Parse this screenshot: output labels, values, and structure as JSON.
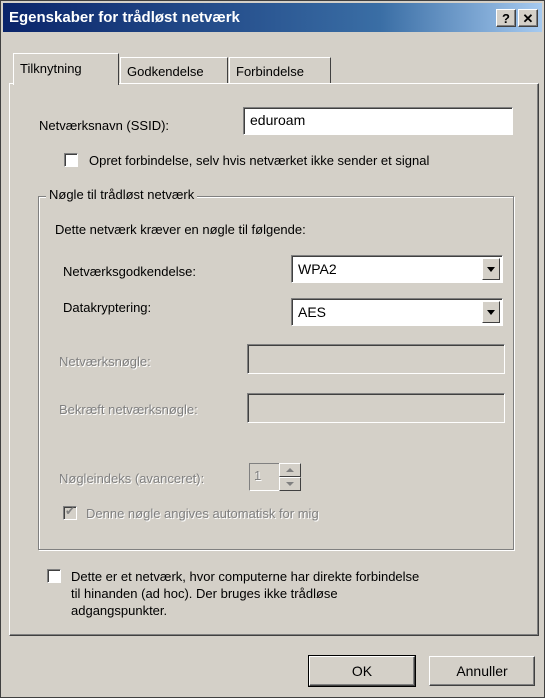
{
  "window": {
    "title": "Egenskaber for trådløst netværk",
    "help_label": "?",
    "close_label": "✕"
  },
  "tabs": [
    {
      "label": "Tilknytning",
      "active": true
    },
    {
      "label": "Godkendelse",
      "active": false
    },
    {
      "label": "Forbindelse",
      "active": false
    }
  ],
  "ssid": {
    "label": "Netværksnavn (SSID):",
    "value": "eduroam"
  },
  "connect_nonbroadcast": {
    "label": "Opret forbindelse, selv hvis netværket ikke sender et signal",
    "checked": false
  },
  "key_group": {
    "legend": "Nøgle til trådløst netværk",
    "intro": "Dette netværk kræver en nøgle til følgende:",
    "auth_label": "Netværksgodkendelse:",
    "auth_value": "WPA2",
    "encryption_label": "Datakryptering:",
    "encryption_value": "AES",
    "network_key_label": "Netværksnøgle:",
    "confirm_key_label": "Bekræft netværksnøgle:",
    "key_index_label": "Nøgleindeks (avanceret):",
    "key_index_value": "1",
    "auto_key_label": "Denne nøgle angives automatisk for mig",
    "auto_key_checked": true
  },
  "adhoc": {
    "label_line1": "Dette er et netværk, hvor computerne har direkte forbindelse",
    "label_line2": "til hinanden (ad hoc). Der bruges ikke trådløse",
    "label_line3": "adgangspunkter.",
    "checked": false
  },
  "buttons": {
    "ok": "OK",
    "cancel": "Annuller"
  }
}
